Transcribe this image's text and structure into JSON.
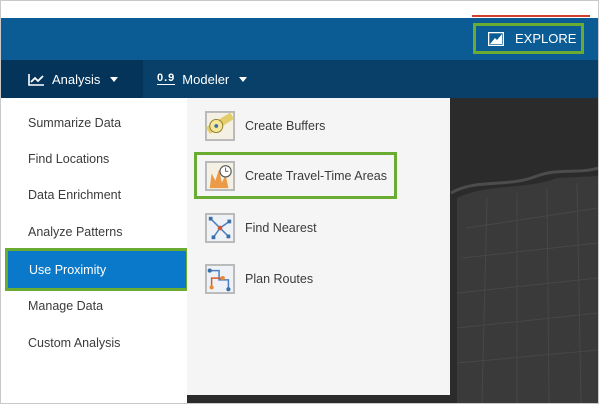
{
  "header": {
    "explore_label": "EXPLORE"
  },
  "nav": {
    "analysis_label": "Analysis",
    "modeler_label": "Modeler",
    "modeler_glyph": "0.9"
  },
  "left_menu": {
    "items": [
      {
        "label": "Summarize Data"
      },
      {
        "label": "Find Locations"
      },
      {
        "label": "Data Enrichment"
      },
      {
        "label": "Analyze Patterns"
      },
      {
        "label": "Use Proximity"
      },
      {
        "label": "Manage Data"
      },
      {
        "label": "Custom Analysis"
      }
    ],
    "active_index": 4
  },
  "tools": {
    "items": [
      {
        "label": "Create Buffers",
        "icon": "buffer-icon"
      },
      {
        "label": "Create Travel-Time Areas",
        "icon": "travel-time-icon"
      },
      {
        "label": "Find Nearest",
        "icon": "find-nearest-icon"
      },
      {
        "label": "Plan Routes",
        "icon": "plan-routes-icon"
      }
    ]
  },
  "colors": {
    "header": "#0b5c94",
    "nav": "#08406a",
    "active": "#0b79c9",
    "highlight_border": "#6aab32",
    "accent_line": "#d2402b",
    "map_background": "#2b2b2b"
  }
}
